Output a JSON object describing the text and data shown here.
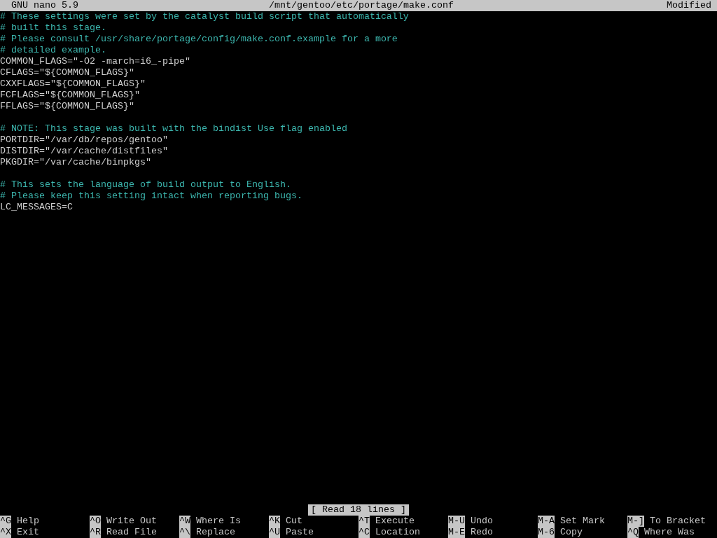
{
  "title_bar": {
    "app": "GNU nano 5.9",
    "file": "/mnt/gentoo/etc/portage/make.conf",
    "state": "Modified"
  },
  "lines": [
    {
      "kind": "comment",
      "text": "# These settings were set by the catalyst build script that automatically"
    },
    {
      "kind": "comment",
      "text": "# built this stage."
    },
    {
      "kind": "comment",
      "text": "# Please consult /usr/share/portage/config/make.conf.example for a more"
    },
    {
      "kind": "comment",
      "text": "# detailed example."
    },
    {
      "kind": "code",
      "text": "COMMON_FLAGS=\"-O2 -march=i6_-pipe\""
    },
    {
      "kind": "code",
      "text": "CFLAGS=\"${COMMON_FLAGS}\""
    },
    {
      "kind": "code",
      "text": "CXXFLAGS=\"${COMMON_FLAGS}\""
    },
    {
      "kind": "code",
      "text": "FCFLAGS=\"${COMMON_FLAGS}\""
    },
    {
      "kind": "code",
      "text": "FFLAGS=\"${COMMON_FLAGS}\""
    },
    {
      "kind": "blank"
    },
    {
      "kind": "comment",
      "text": "# NOTE: This stage was built with the bindist Use flag enabled"
    },
    {
      "kind": "code",
      "text": "PORTDIR=\"/var/db/repos/gentoo\""
    },
    {
      "kind": "code",
      "text": "DISTDIR=\"/var/cache/distfiles\""
    },
    {
      "kind": "code",
      "text": "PKGDIR=\"/var/cache/binpkgs\""
    },
    {
      "kind": "blank"
    },
    {
      "kind": "comment",
      "text": "# This sets the language of build output to English."
    },
    {
      "kind": "comment",
      "text": "# Please keep this setting intact when reporting bugs."
    },
    {
      "kind": "code",
      "text": "LC_MESSAGES=C"
    }
  ],
  "status": "[ Read 18 lines ]",
  "shortcuts": [
    {
      "key": "^G",
      "label": "Help"
    },
    {
      "key": "^O",
      "label": "Write Out"
    },
    {
      "key": "^W",
      "label": "Where Is"
    },
    {
      "key": "^K",
      "label": "Cut"
    },
    {
      "key": "^T",
      "label": "Execute"
    },
    {
      "key": "M-U",
      "label": "Undo"
    },
    {
      "key": "M-A",
      "label": "Set Mark"
    },
    {
      "key": "M-]",
      "label": "To Bracket"
    },
    {
      "key": "^X",
      "label": "Exit"
    },
    {
      "key": "^R",
      "label": "Read File"
    },
    {
      "key": "^\\",
      "label": "Replace"
    },
    {
      "key": "^U",
      "label": "Paste"
    },
    {
      "key": "^C",
      "label": "Location"
    },
    {
      "key": "M-E",
      "label": "Redo"
    },
    {
      "key": "M-6",
      "label": "Copy"
    },
    {
      "key": "^Q",
      "label": "Where Was"
    }
  ]
}
